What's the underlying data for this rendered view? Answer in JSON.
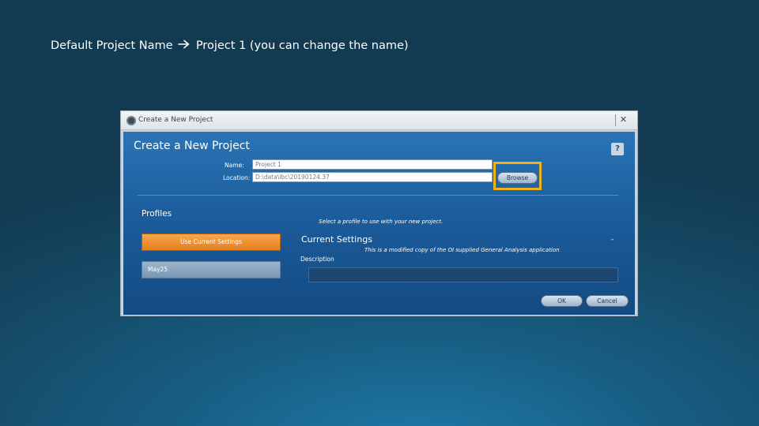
{
  "slide": {
    "caption_left": "Default Project Name",
    "caption_right": "Project 1 (you can change the name)",
    "arrow_icon": "right-arrow-icon"
  },
  "window": {
    "title": "Create a New Project",
    "close_label": "✕"
  },
  "dialog": {
    "heading": "Create a New Project",
    "help_label": "?",
    "name_label": "Name:",
    "name_value": "Project 1",
    "location_label": "Location:",
    "location_value": "D:\\data\\lbc\\20190124.37",
    "browse_label": "Browse",
    "highlight_color": "#f0b21a",
    "profiles_heading": "Profiles",
    "select_hint": "Select a profile to use with your new project.",
    "profiles": [
      {
        "label": "Use Current Settings",
        "selected": true
      },
      {
        "label": "May25",
        "selected": false
      }
    ],
    "current_settings_heading": "Current Settings",
    "current_settings_desc": "This is a modified copy of the OI supplied General Analysis application",
    "description_label": "Description",
    "ok_label": "OK",
    "cancel_label": "Cancel"
  }
}
